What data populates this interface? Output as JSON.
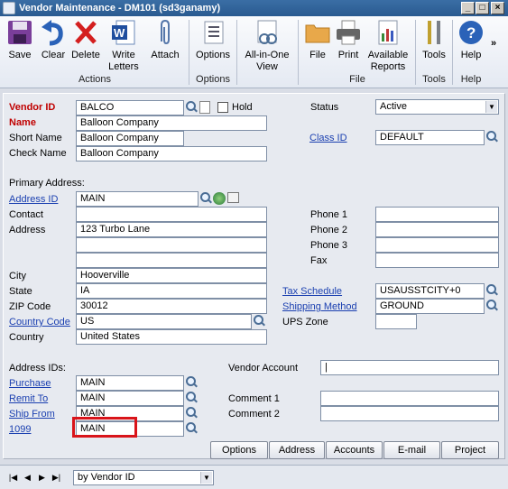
{
  "window": {
    "title": "Vendor Maintenance  -  DM101 (sd3ganamy)",
    "min": "_",
    "max": "□",
    "close": "×"
  },
  "ribbon": {
    "save": "Save",
    "clear": "Clear",
    "delete": "Delete",
    "write_letters": "Write Letters",
    "attach": "Attach",
    "options": "Options",
    "all_in_one": "All-in-One View",
    "file": "File",
    "print": "Print",
    "available_reports": "Available Reports",
    "tools": "Tools",
    "help": "Help",
    "more": "»",
    "groups": {
      "actions": "Actions",
      "options": "Options",
      "file": "File",
      "tools": "Tools",
      "help": "Help"
    },
    "icon_names": [
      "floppy-disk-icon",
      "undo-icon",
      "delete-x-icon",
      "word-doc-icon",
      "paperclip-icon",
      "options-list-icon",
      "all-in-one-icon",
      "folder-icon",
      "printer-icon",
      "reports-icon",
      "tools-icon",
      "help-icon"
    ]
  },
  "labels": {
    "vendor_id": "Vendor ID",
    "name": "Name",
    "short_name": "Short Name",
    "check_name": "Check Name",
    "status": "Status",
    "class_id": "Class ID",
    "hold": "Hold",
    "primary_address": "Primary Address:",
    "address_id": "Address ID",
    "contact": "Contact",
    "address": "Address",
    "city": "City",
    "state": "State",
    "zip": "ZIP Code",
    "country_code": "Country Code",
    "country": "Country",
    "phone1": "Phone 1",
    "phone2": "Phone 2",
    "phone3": "Phone 3",
    "fax": "Fax",
    "tax_schedule": "Tax Schedule",
    "shipping_method": "Shipping Method",
    "ups_zone": "UPS Zone",
    "address_ids": "Address IDs:",
    "purchase": "Purchase",
    "remit_to": "Remit To",
    "ship_from": "Ship From",
    "n1099": "1099",
    "vendor_account": "Vendor Account",
    "comment1": "Comment 1",
    "comment2": "Comment 2"
  },
  "values": {
    "vendor_id": "BALCO",
    "name": "Balloon Company",
    "short_name": "Balloon Company",
    "check_name": "Balloon Company",
    "status": "Active",
    "class_id": "DEFAULT",
    "address_id": "MAIN",
    "contact": "",
    "address1": "123 Turbo Lane",
    "address2": "",
    "address3": "",
    "city": "Hooverville",
    "state": "IA",
    "zip": "30012",
    "country_code": "US",
    "country": "United States",
    "phone1": "",
    "phone2": "",
    "phone3": "",
    "fax": "",
    "tax_schedule": "USAUSSTCITY+0",
    "shipping_method": "GROUND",
    "ups_zone": "",
    "purchase": "MAIN",
    "remit_to": "MAIN",
    "ship_from": "MAIN",
    "n1099": "MAIN",
    "vendor_account": "|",
    "comment1": "",
    "comment2": ""
  },
  "buttons": {
    "options": "Options",
    "address": "Address",
    "accounts": "Accounts",
    "email": "E-mail",
    "project": "Project"
  },
  "statusbar": {
    "first": "|◀",
    "prev": "◀",
    "next": "▶",
    "last": "▶|",
    "sort": "by Vendor ID"
  },
  "colors": {
    "required_label": "#c00000",
    "link": "#1a3fb0",
    "highlight": "#d9141a"
  }
}
